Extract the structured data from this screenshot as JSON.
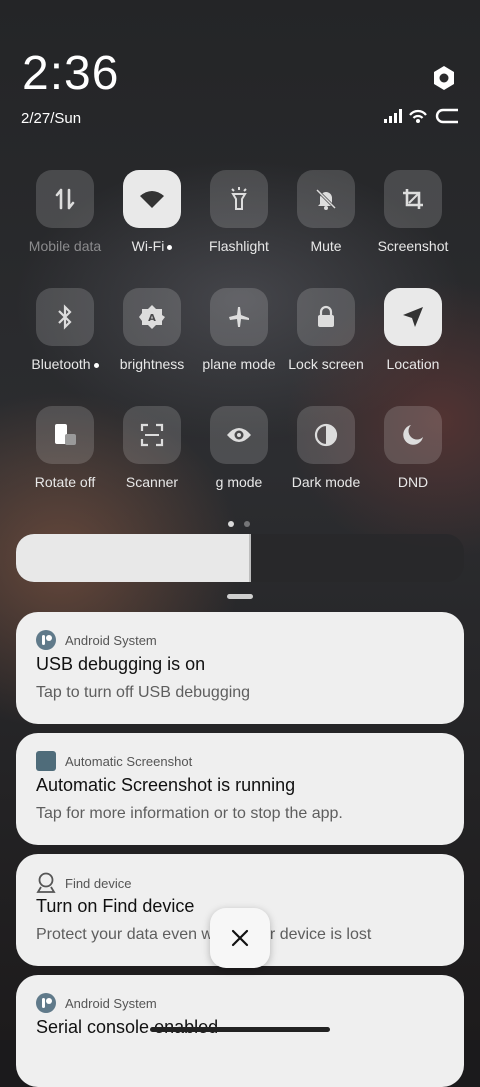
{
  "status": {
    "time": "2:36",
    "date": "2/27/Sun"
  },
  "tiles": [
    {
      "label": "Mobile data",
      "icon": "mobile-data-icon",
      "on": false,
      "dim": true
    },
    {
      "label": "Wi-Fi",
      "icon": "wifi-icon",
      "on": true,
      "dot": true
    },
    {
      "label": "Flashlight",
      "icon": "flashlight-icon",
      "on": false
    },
    {
      "label": "Mute",
      "icon": "mute-bell-icon",
      "on": false
    },
    {
      "label": "Screenshot",
      "icon": "screenshot-crop-icon",
      "on": false
    },
    {
      "label": "Bluetooth",
      "icon": "bluetooth-icon",
      "on": false,
      "dot": true
    },
    {
      "label": "brightness",
      "icon": "auto-brightness-icon",
      "on": false
    },
    {
      "label": "plane mode",
      "icon": "airplane-icon",
      "on": false
    },
    {
      "label": "Lock screen",
      "icon": "lock-icon",
      "on": false
    },
    {
      "label": "Location",
      "icon": "location-arrow-icon",
      "on": true
    },
    {
      "label": "Rotate off",
      "icon": "rotate-lock-icon",
      "on": false
    },
    {
      "label": "Scanner",
      "icon": "scanner-icon",
      "on": false
    },
    {
      "label": "g mode",
      "icon": "eye-icon",
      "on": false
    },
    {
      "label": "Dark mode",
      "icon": "dark-mode-icon",
      "on": false
    },
    {
      "label": "DND",
      "icon": "moon-icon",
      "on": false
    }
  ],
  "brightness_level": 0.52,
  "notifications": [
    {
      "app": "Android System",
      "title": "USB debugging is on",
      "body": "Tap to turn off USB debugging",
      "icon": "android-system-icon"
    },
    {
      "app": "Automatic Screenshot",
      "title": "Automatic Screenshot is running",
      "body": "Tap for more information or to stop the app.",
      "icon": "auto-screenshot-app-icon"
    },
    {
      "app": "Find device",
      "title": "Turn on Find device",
      "body": "Protect your data even when your device is lost",
      "icon": "find-device-icon"
    },
    {
      "app": "Android System",
      "title": "Serial console enabled",
      "body": "",
      "icon": "android-system-icon"
    }
  ],
  "colors": {
    "tile_on": "#e9e9e9",
    "tile_off": "rgba(255,255,255,0.16)",
    "card": "#efefef"
  }
}
